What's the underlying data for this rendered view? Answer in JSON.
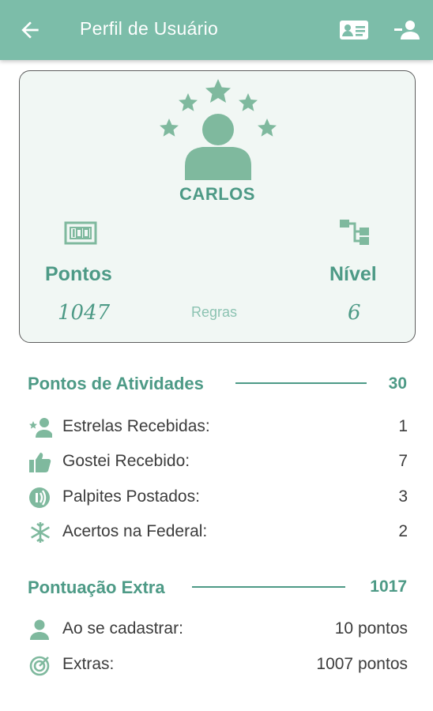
{
  "colors": {
    "primary": "#7cbda9",
    "accent": "#4d9a86",
    "card_bg": "#f1f7f4",
    "link": "#8cc3b2"
  },
  "appbar": {
    "title": "Perfil de Usuário",
    "icons": [
      "back-arrow-icon",
      "id-card-icon",
      "person-remove-icon"
    ]
  },
  "profile": {
    "username": "CARLOS",
    "points_label": "Pontos",
    "points_value": "1047",
    "rules_label": "Regras",
    "level_label": "Nível",
    "level_value": "6",
    "icons": [
      "user-stars-icon",
      "score-counter-icon",
      "hierarchy-icon"
    ]
  },
  "activities": {
    "title": "Pontos de Atividades",
    "total": "30",
    "items": [
      {
        "icon": "star-person-icon",
        "label": "Estrelas Recebidas:",
        "value": "1"
      },
      {
        "icon": "thumbs-up-icon",
        "label": "Gostei Recebido:",
        "value": "7"
      },
      {
        "icon": "broadcast-icon",
        "label": "Palpites Postados:",
        "value": "3"
      },
      {
        "icon": "snowflake-icon",
        "label": "Acertos na Federal:",
        "value": "2"
      }
    ]
  },
  "extra": {
    "title": "Pontuação Extra",
    "total": "1017",
    "items": [
      {
        "icon": "person-icon",
        "label": "Ao se cadastrar:",
        "value": "10 pontos"
      },
      {
        "icon": "spiral-icon",
        "label": "Extras:",
        "value": "1007 pontos"
      }
    ]
  }
}
